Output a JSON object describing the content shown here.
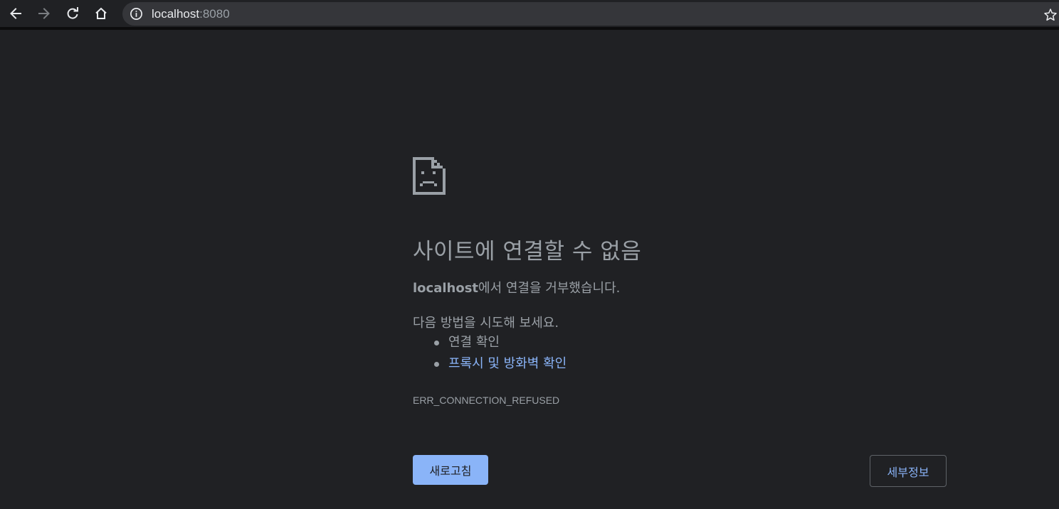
{
  "toolbar": {
    "back_icon": "arrow-left-icon",
    "forward_icon": "arrow-right-icon",
    "reload_icon": "reload-icon",
    "home_icon": "home-icon",
    "info_icon": "info-icon",
    "bookmark_icon": "star-icon",
    "url_host": "localhost",
    "url_port": ":8080"
  },
  "error": {
    "icon": "sad-page-icon",
    "title": "사이트에 연결할 수 없음",
    "host": "localhost",
    "message_suffix": "에서 연결을 거부했습니다.",
    "suggestions_heading": "다음 방법을 시도해 보세요.",
    "suggestions": [
      {
        "label": "연결 확인",
        "is_link": false
      },
      {
        "label": "프록시 및 방화벽 확인",
        "is_link": true
      }
    ],
    "code": "ERR_CONNECTION_REFUSED",
    "reload_label": "새로고침",
    "details_label": "세부정보"
  },
  "colors": {
    "background": "#202124",
    "text": "#9aa0a6",
    "link": "#8ab4f8",
    "primary_button": "#8ab4f8"
  }
}
